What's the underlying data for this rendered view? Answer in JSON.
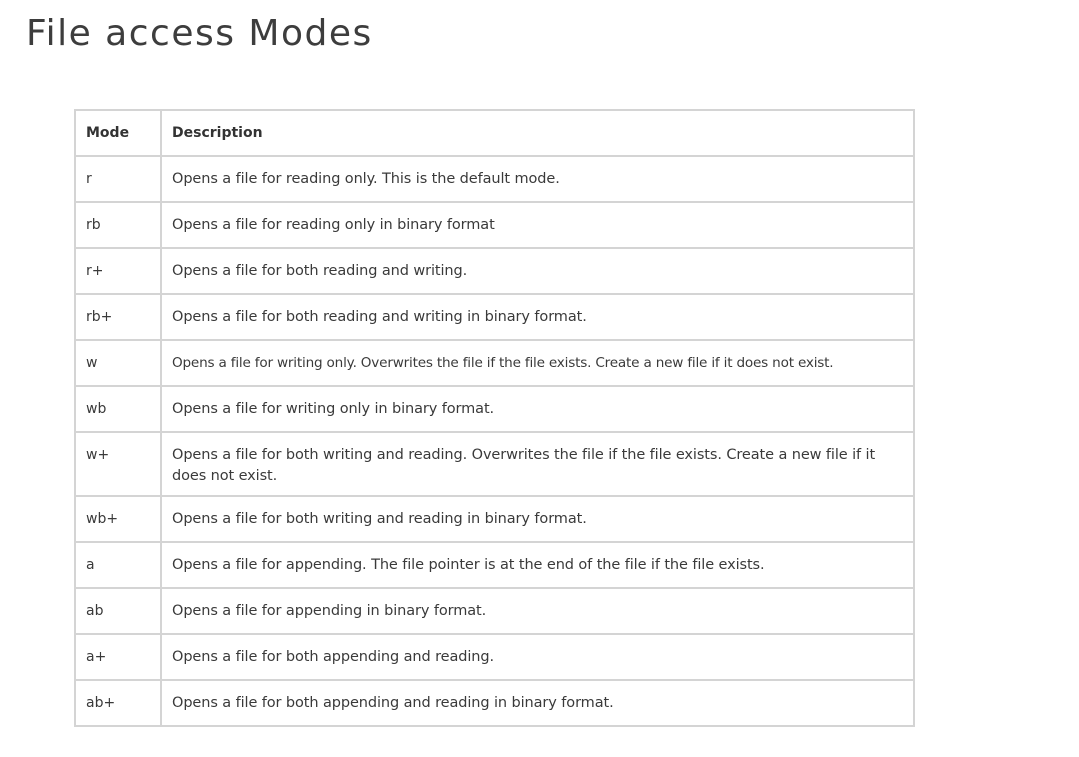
{
  "title": "File access Modes",
  "table": {
    "headers": {
      "mode": "Mode",
      "description": "Description"
    },
    "rows": [
      {
        "mode": "r",
        "description": "Opens a file for reading only. This is the default mode."
      },
      {
        "mode": "rb",
        "description": "Opens a file for reading only in binary format"
      },
      {
        "mode": "r+",
        "description": "Opens a file for both reading and writing."
      },
      {
        "mode": "rb+",
        "description": "Opens a file for both reading and writing in binary format."
      },
      {
        "mode": "w",
        "description": "Opens a file for writing only. Overwrites the file if the file exists. Create a new file if it does not exist."
      },
      {
        "mode": "wb",
        "description": "Opens a file for writing only in binary format."
      },
      {
        "mode": "w+",
        "description": "Opens a file for both writing and reading. Overwrites the file if the file exists. Create a new file if it does not exist."
      },
      {
        "mode": "wb+",
        "description": "Opens a file for both writing and reading in binary format."
      },
      {
        "mode": "a",
        "description": "Opens a file for appending. The file pointer is at the end of the file if the file exists."
      },
      {
        "mode": "ab",
        "description": "Opens a file for appending in binary format."
      },
      {
        "mode": "a+",
        "description": "Opens a file for both appending and reading."
      },
      {
        "mode": "ab+",
        "description": "Opens a file for both appending and reading in binary format."
      }
    ]
  }
}
